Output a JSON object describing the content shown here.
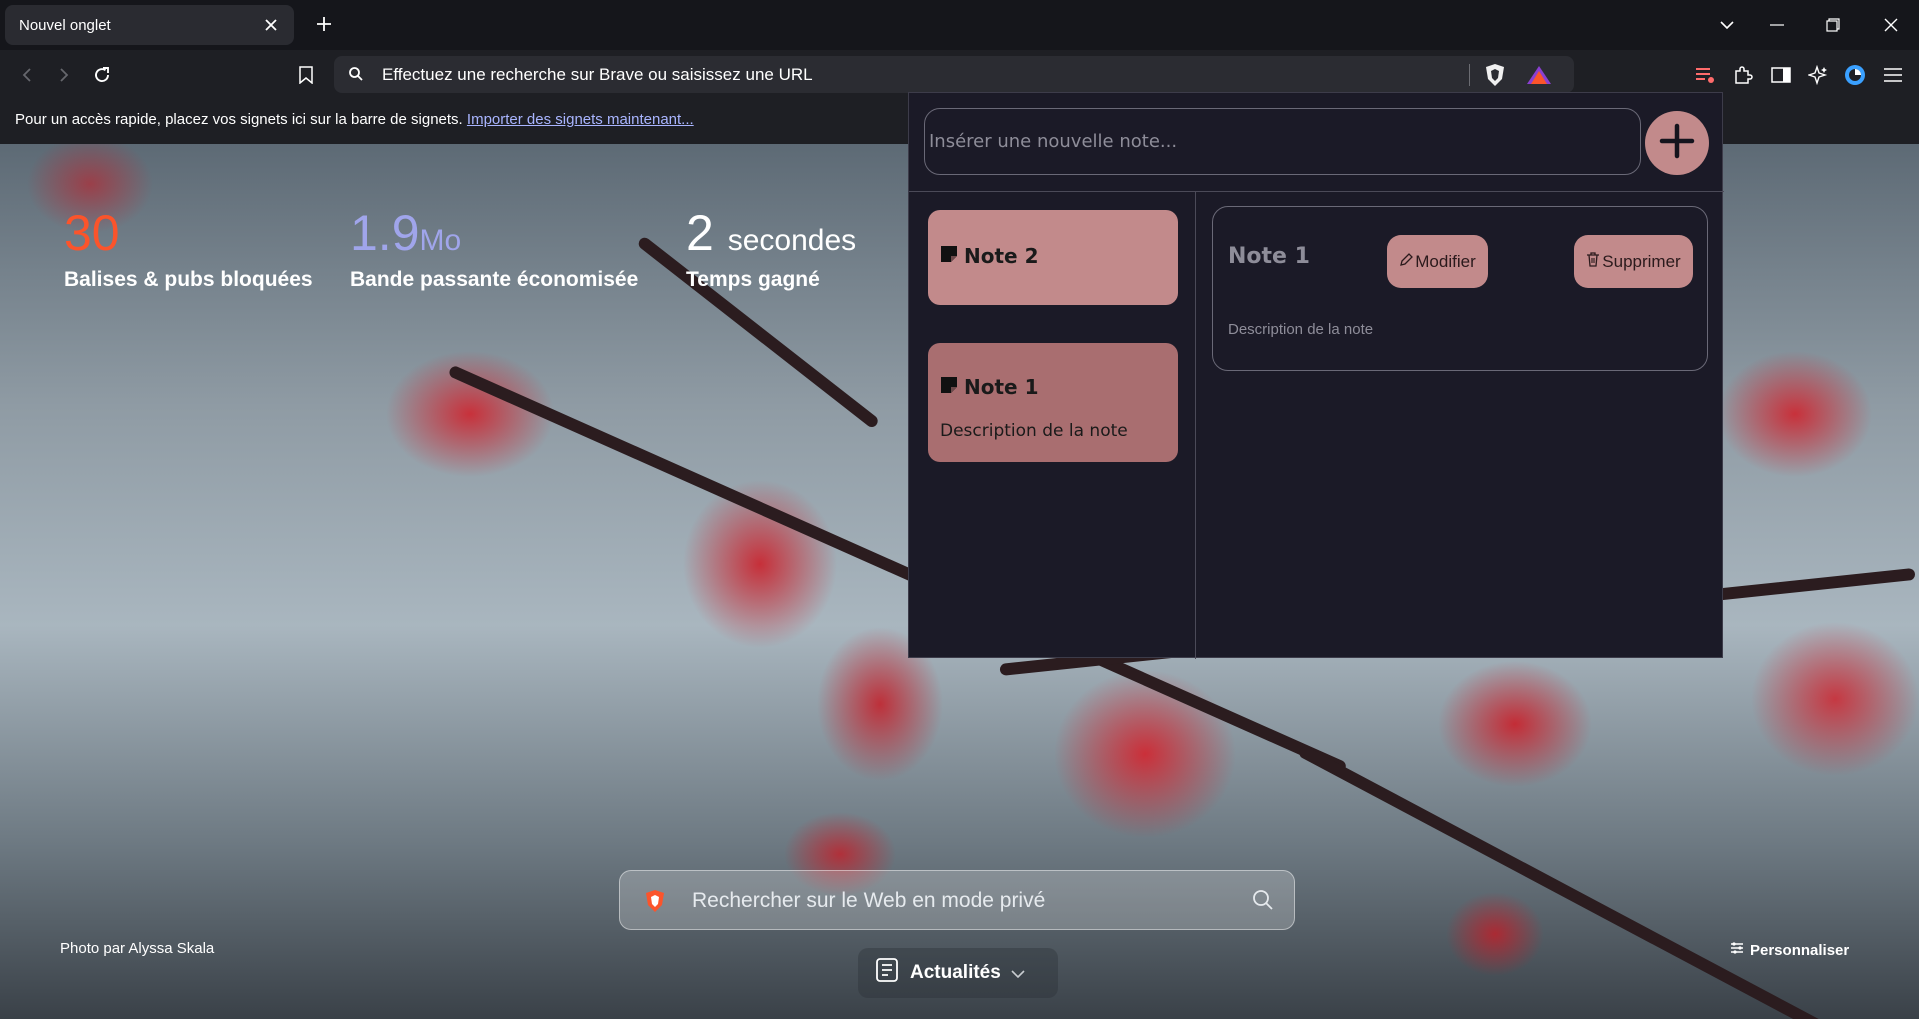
{
  "tab": {
    "title": "Nouvel onglet"
  },
  "omnibox": {
    "text": "Effectuez une recherche sur Brave ou saisissez une URL",
    "badge_count": "1"
  },
  "bookmarks_bar": {
    "text": "Pour un accès rapide, placez vos signets ici sur la barre de signets.",
    "link": "Importer des signets maintenant..."
  },
  "stats": {
    "trackers": {
      "value": "30",
      "label": "Balises & pubs bloquées",
      "color": "#fb542b"
    },
    "bandwidth": {
      "value": "1.9",
      "unit": "Mo",
      "label": "Bande passante économisée",
      "color": "#a0a5eb"
    },
    "time": {
      "value": "2",
      "unit": "secondes",
      "label": "Temps gagné",
      "color": "#ffffff"
    }
  },
  "search": {
    "placeholder": "Rechercher sur le Web en mode privé"
  },
  "footer": {
    "photo_credit": "Photo par Alyssa Skala",
    "news_label": "Actualités",
    "customize_label": "Personnaliser"
  },
  "notes_popup": {
    "input_placeholder": "Insérer une nouvelle note...",
    "notes": [
      {
        "title": "Note 2",
        "description": ""
      },
      {
        "title": "Note 1",
        "description": "Description de la note"
      }
    ],
    "selected": {
      "title": "Note 1",
      "description": "Description de la note",
      "edit_label": "Modifier",
      "delete_label": "Supprimer"
    },
    "accent_color": "#c28a8b"
  }
}
